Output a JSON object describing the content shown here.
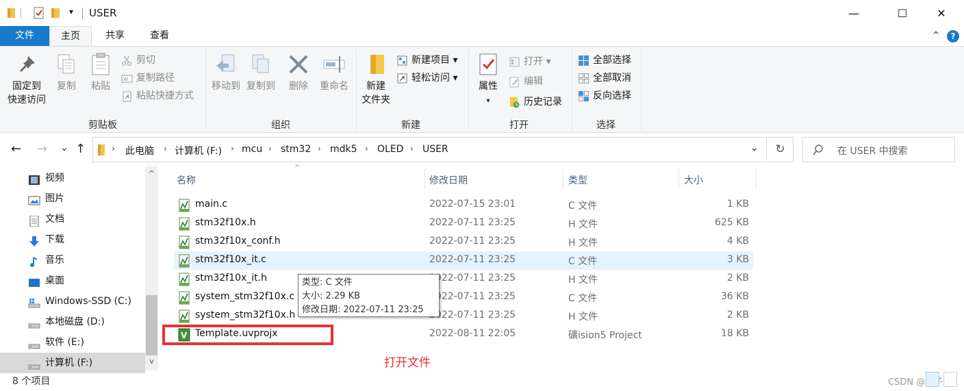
{
  "window": {
    "title": "USER",
    "minimize_glyph": "—",
    "maximize_glyph": "☐",
    "close_glyph": "✕",
    "quick_access_dropdown": "▾"
  },
  "tabs": {
    "file": "文件",
    "home": "主页",
    "share": "共享",
    "view": "查看",
    "collapse_glyph": "^",
    "help_glyph": "?"
  },
  "ribbon": {
    "clipboard": {
      "label": "剪贴板",
      "pin_line1": "固定到",
      "pin_line2": "快速访问",
      "copy": "复制",
      "paste": "粘贴",
      "cut": "剪切",
      "copy_path": "复制路径",
      "paste_shortcut": "粘贴快捷方式"
    },
    "organize": {
      "label": "组织",
      "move_to": "移动到",
      "copy_to": "复制到",
      "delete": "删除",
      "rename": "重命名"
    },
    "new": {
      "label": "新建",
      "new_folder_line1": "新建",
      "new_folder_line2": "文件夹",
      "new_item": "新建项目",
      "easy_access": "轻松访问"
    },
    "open": {
      "label": "打开",
      "properties": "属性",
      "open": "打开",
      "edit": "编辑",
      "history": "历史记录"
    },
    "select": {
      "label": "选择",
      "select_all": "全部选择",
      "select_none": "全部取消",
      "invert": "反向选择"
    }
  },
  "address": {
    "back": "←",
    "forward": "→",
    "recent": "⌄",
    "up": "↑",
    "crumbs": [
      "此电脑",
      "计算机 (F:)",
      "mcu",
      "stm32",
      "mdk5",
      "OLED",
      "USER"
    ],
    "dropdown": "⌄",
    "refresh": "↻",
    "search_placeholder": "在 USER 中搜索"
  },
  "sidebar": {
    "items": [
      {
        "label": "视频"
      },
      {
        "label": "图片"
      },
      {
        "label": "文档"
      },
      {
        "label": "下载"
      },
      {
        "label": "音乐"
      },
      {
        "label": "桌面"
      },
      {
        "label": "Windows-SSD (C:)"
      },
      {
        "label": "本地磁盘 (D:)"
      },
      {
        "label": "软件 (E:)"
      },
      {
        "label": "计算机 (F:)"
      }
    ],
    "scroll_up": "^",
    "scroll_down": "v"
  },
  "columns": {
    "name": "名称",
    "date": "修改日期",
    "type": "类型",
    "size": "大小",
    "sort_glyph": "^"
  },
  "files": [
    {
      "name": "main.c",
      "date": "2022-07-15 23:01",
      "type": "C 文件",
      "size": "1 KB"
    },
    {
      "name": "stm32f10x.h",
      "date": "2022-07-11 23:25",
      "type": "H 文件",
      "size": "625 KB"
    },
    {
      "name": "stm32f10x_conf.h",
      "date": "2022-07-11 23:25",
      "type": "H 文件",
      "size": "4 KB"
    },
    {
      "name": "stm32f10x_it.c",
      "date": "2022-07-11 23:25",
      "type": "C 文件",
      "size": "3 KB"
    },
    {
      "name": "stm32f10x_it.h",
      "date": "2022-07-11 23:25",
      "type": "H 文件",
      "size": "2 KB"
    },
    {
      "name": "system_stm32f10x.c",
      "date": "2022-07-11 23:25",
      "type": "C 文件",
      "size": "36 KB"
    },
    {
      "name": "system_stm32f10x.h",
      "date": "2022-07-11 23:25",
      "type": "H 文件",
      "size": "2 KB"
    },
    {
      "name": "Template.uvprojx",
      "date": "2022-08-11 22:05",
      "type": "礦ision5 Project",
      "size": "18 KB"
    }
  ],
  "tooltip": {
    "line1": "类型: C 文件",
    "line2": "大小: 2.29 KB",
    "line3": "修改日期: 2022-07-11 23:25"
  },
  "annotation": "打开文件",
  "status": "8 个项目",
  "watermark": "CSDN @橙子"
}
